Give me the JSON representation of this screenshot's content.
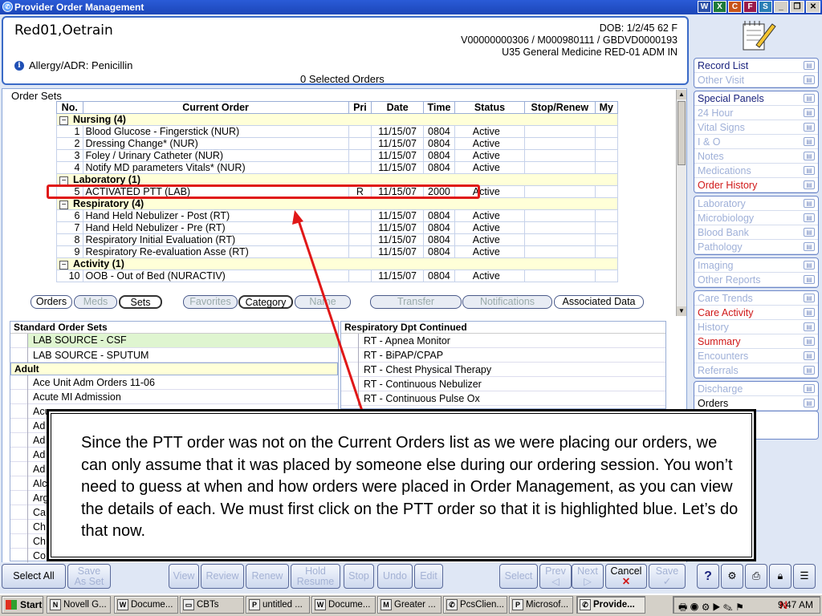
{
  "window": {
    "title": "Provider Order Management",
    "app_buttons": [
      "W",
      "X",
      "C",
      "F",
      "S"
    ]
  },
  "patient": {
    "name": "Red01,Oetrain",
    "dob": "DOB: 1/2/45 62 F",
    "ids": "V00000000306 / M000980111 / GBDVD0000193",
    "location": "U35 General Medicine RED-01  ADM IN",
    "allergy": "Allergy/ADR: Penicillin",
    "selected_orders": "0 Selected Orders"
  },
  "order_sets": {
    "label": "Order Sets",
    "columns": [
      "No.",
      "Current Order",
      "Pri",
      "Date",
      "Time",
      "Status",
      "Stop/Renew",
      "My"
    ],
    "groups": [
      {
        "name": "Nursing   (4)",
        "rows": [
          {
            "no": "1",
            "order": "Blood Glucose - Fingerstick (NUR)",
            "pri": "",
            "date": "11/15/07",
            "time": "0804",
            "status": "Active"
          },
          {
            "no": "2",
            "order": "Dressing Change* (NUR)",
            "pri": "",
            "date": "11/15/07",
            "time": "0804",
            "status": "Active"
          },
          {
            "no": "3",
            "order": "Foley / Urinary Catheter (NUR)",
            "pri": "",
            "date": "11/15/07",
            "time": "0804",
            "status": "Active"
          },
          {
            "no": "4",
            "order": "Notify MD parameters Vitals* (NUR)",
            "pri": "",
            "date": "11/15/07",
            "time": "0804",
            "status": "Active"
          }
        ]
      },
      {
        "name": "Laboratory   (1)",
        "rows": [
          {
            "no": "5",
            "order": "ACTIVATED PTT (LAB)",
            "pri": "R",
            "date": "11/15/07",
            "time": "2000",
            "status": "Active"
          }
        ]
      },
      {
        "name": "Respiratory   (4)",
        "rows": [
          {
            "no": "6",
            "order": "Hand Held Nebulizer - Post (RT)",
            "pri": "",
            "date": "11/15/07",
            "time": "0804",
            "status": "Active"
          },
          {
            "no": "7",
            "order": "Hand Held Nebulizer - Pre (RT)",
            "pri": "",
            "date": "11/15/07",
            "time": "0804",
            "status": "Active"
          },
          {
            "no": "8",
            "order": "Respiratory Initial Evaluation (RT)",
            "pri": "",
            "date": "11/15/07",
            "time": "0804",
            "status": "Active"
          },
          {
            "no": "9",
            "order": "Respiratory Re-evaluation Asse (RT)",
            "pri": "",
            "date": "11/15/07",
            "time": "0804",
            "status": "Active"
          }
        ]
      },
      {
        "name": "Activity   (1)",
        "rows": [
          {
            "no": "10",
            "order": "OOB - Out of Bed (NURACTIV)",
            "pri": "",
            "date": "11/15/07",
            "time": "0804",
            "status": "Active"
          }
        ]
      }
    ]
  },
  "tabs": {
    "orders": "Orders",
    "meds": "Meds",
    "sets": "Sets",
    "favorites": "Favorites",
    "category": "Category",
    "name": "Name",
    "transfer": "Transfer",
    "notifications": "Notifications",
    "associated": "Associated Data"
  },
  "standard_sets": {
    "header": "Standard Order Sets",
    "items": [
      "LAB SOURCE - CSF",
      "LAB SOURCE - SPUTUM"
    ],
    "adult_header": "Adult",
    "adult_items": [
      "Ace Unit Adm Orders 11-06",
      "Acute MI Admission",
      "Acu",
      "Ad",
      "Ad",
      "Ad",
      "Ad",
      "Alc",
      "Arg",
      "Ca",
      "Ch",
      "Ch",
      "Co"
    ]
  },
  "resp_continued": {
    "header": "Respiratory Dpt Continued",
    "items": [
      "RT - Apnea Monitor",
      "RT - BiPAP/CPAP",
      "RT - Chest Physical Therapy",
      "RT - Continuous Nebulizer",
      "RT - Continuous Pulse Ox"
    ]
  },
  "callout": {
    "text": "Since the PTT order was not on the Current Orders list as we were placing our orders, we can only assume that it was placed by someone else during our ordering session. You won’t need to guess at when and how orders were placed in Order Management, as you can view the details of each. We must first click on the PTT order so that it is highlighted blue. Let’s do that now."
  },
  "sidebar": {
    "group1": [
      {
        "label": "Record List",
        "state": "normal"
      },
      {
        "label": "Other Visit",
        "state": "disabled"
      }
    ],
    "group2": [
      {
        "label": "Special Panels",
        "state": "normal"
      },
      {
        "label": "24 Hour",
        "state": "disabled"
      },
      {
        "label": "Vital Signs",
        "state": "disabled"
      },
      {
        "label": "I & O",
        "state": "disabled"
      },
      {
        "label": "Notes",
        "state": "disabled"
      },
      {
        "label": "Medications",
        "state": "disabled"
      },
      {
        "label": "Order History",
        "state": "red"
      }
    ],
    "group3": [
      {
        "label": "Laboratory",
        "state": "disabled"
      },
      {
        "label": "Microbiology",
        "state": "disabled"
      },
      {
        "label": "Blood Bank",
        "state": "disabled"
      },
      {
        "label": "Pathology",
        "state": "disabled"
      }
    ],
    "group4": [
      {
        "label": "Imaging",
        "state": "disabled"
      },
      {
        "label": "Other Reports",
        "state": "disabled"
      }
    ],
    "group5": [
      {
        "label": "Care Trends",
        "state": "disabled"
      },
      {
        "label": "Care Activity",
        "state": "red"
      },
      {
        "label": "History",
        "state": "disabled"
      },
      {
        "label": "Summary",
        "state": "red"
      },
      {
        "label": "Encounters",
        "state": "disabled"
      },
      {
        "label": "Referrals",
        "state": "disabled"
      }
    ],
    "group6": [
      {
        "label": "Discharge",
        "state": "disabled"
      },
      {
        "label": "Orders",
        "state": "black"
      }
    ]
  },
  "toolbar": {
    "select_all": "Select All",
    "save_as_set_1": "Save",
    "save_as_set_2": "As Set",
    "view": "View",
    "review": "Review",
    "renew": "Renew",
    "hold_1": "Hold",
    "hold_2": "Resume",
    "stop": "Stop",
    "undo": "Undo",
    "edit": "Edit",
    "select": "Select",
    "prev": "Prev",
    "next": "Next",
    "cancel": "Cancel",
    "save": "Save",
    "help": "?"
  },
  "taskbar": {
    "start": "Start",
    "tasks": [
      "Novell G...",
      "Docume...",
      "CBTs",
      "untitled ...",
      "Docume...",
      "Greater ...",
      "PcsClien...",
      "Microsof...",
      "Provide..."
    ],
    "time": "9:47 AM"
  }
}
